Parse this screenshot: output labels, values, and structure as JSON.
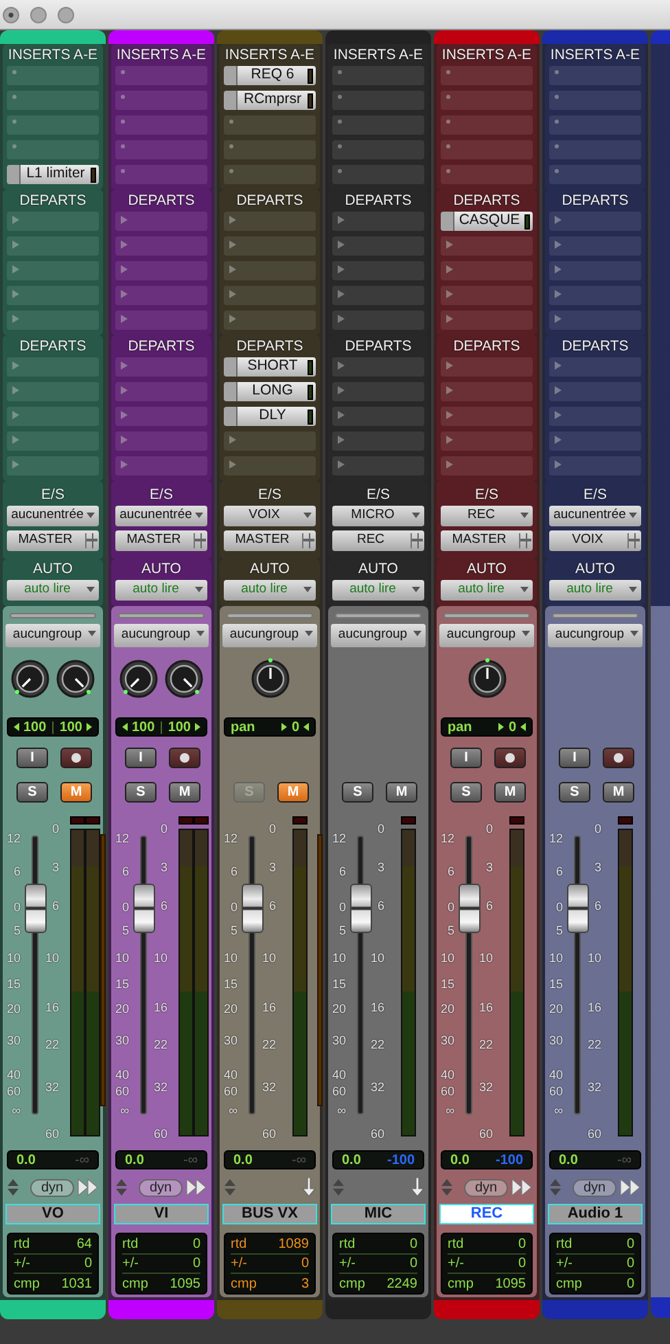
{
  "channels": [
    {
      "kind": "audio",
      "color": "#20c48a",
      "inserts": {
        "header": "INSERTS A-E",
        "slots": [
          {
            "kind": "empty"
          },
          {
            "kind": "empty"
          },
          {
            "kind": "empty"
          },
          {
            "kind": "empty"
          },
          {
            "kind": "plugin",
            "name": "L1 limiter"
          }
        ]
      },
      "sends_a": {
        "header": "DEPARTS",
        "slots": [
          {
            "kind": "empty"
          },
          {
            "kind": "empty"
          },
          {
            "kind": "empty"
          },
          {
            "kind": "empty"
          },
          {
            "kind": "empty"
          }
        ]
      },
      "sends_b": {
        "header": "DEPARTS",
        "slots": [
          {
            "kind": "empty"
          },
          {
            "kind": "empty"
          },
          {
            "kind": "empty"
          },
          {
            "kind": "empty"
          },
          {
            "kind": "empty"
          }
        ]
      },
      "io": {
        "header": "E/S",
        "input": "aucunentrée",
        "output": "MASTER"
      },
      "automation": {
        "header": "AUTO",
        "mode": "auto lire"
      },
      "group": "aucungroup",
      "pan": {
        "kind": "stereo",
        "knobs": [
          {
            "kind": "left"
          },
          {
            "kind": "right"
          }
        ],
        "values": [
          "100",
          "100"
        ]
      },
      "input_buttons": [
        {
          "kind": "input",
          "label": "I"
        },
        {
          "kind": "record",
          "armed": false
        }
      ],
      "solo": {
        "label": "S",
        "on": false,
        "disabled": false
      },
      "mute": {
        "label": "M",
        "on": true
      },
      "fader_scale": [
        "12",
        "6",
        "0",
        "5",
        "10",
        "15",
        "20",
        "30",
        "40",
        "60",
        "∞"
      ],
      "meter_scale": [
        "0",
        "3",
        "6",
        "10",
        "16",
        "22",
        "32",
        "60"
      ],
      "fader": {
        "level": 0.745
      },
      "meter": {
        "kind": "stereo"
      },
      "gain_reduction": true,
      "volume": "0.0",
      "peak": {
        "text": "-∞",
        "active": false
      },
      "dyn": "dyn",
      "name": {
        "text": "VO",
        "selected": false
      },
      "delay": {
        "warning": false,
        "rows": [
          {
            "label": "rtd",
            "value": "64"
          },
          {
            "label": "+/-",
            "value": "0"
          },
          {
            "label": "cmp",
            "value": "1031"
          }
        ]
      }
    },
    {
      "kind": "audio",
      "color": "#c000ff",
      "inserts": {
        "header": "INSERTS A-E",
        "slots": [
          {
            "kind": "empty"
          },
          {
            "kind": "empty"
          },
          {
            "kind": "empty"
          },
          {
            "kind": "empty"
          },
          {
            "kind": "empty"
          }
        ]
      },
      "sends_a": {
        "header": "DEPARTS",
        "slots": [
          {
            "kind": "empty"
          },
          {
            "kind": "empty"
          },
          {
            "kind": "empty"
          },
          {
            "kind": "empty"
          },
          {
            "kind": "empty"
          }
        ]
      },
      "sends_b": {
        "header": "DEPARTS",
        "slots": [
          {
            "kind": "empty"
          },
          {
            "kind": "empty"
          },
          {
            "kind": "empty"
          },
          {
            "kind": "empty"
          },
          {
            "kind": "empty"
          }
        ]
      },
      "io": {
        "header": "E/S",
        "input": "aucunentrée",
        "output": "MASTER"
      },
      "automation": {
        "header": "AUTO",
        "mode": "auto lire"
      },
      "group": "aucungroup",
      "pan": {
        "kind": "stereo",
        "knobs": [
          {
            "kind": "left"
          },
          {
            "kind": "right"
          }
        ],
        "values": [
          "100",
          "100"
        ]
      },
      "input_buttons": [
        {
          "kind": "input",
          "label": "I"
        },
        {
          "kind": "record",
          "armed": false
        }
      ],
      "solo": {
        "label": "S",
        "on": false,
        "disabled": false
      },
      "mute": {
        "label": "M",
        "on": false
      },
      "fader_scale": [
        "12",
        "6",
        "0",
        "5",
        "10",
        "15",
        "20",
        "30",
        "40",
        "60",
        "∞"
      ],
      "meter_scale": [
        "0",
        "3",
        "6",
        "10",
        "16",
        "22",
        "32",
        "60"
      ],
      "fader": {
        "level": 0.745
      },
      "meter": {
        "kind": "stereo"
      },
      "gain_reduction": false,
      "volume": "0.0",
      "peak": {
        "text": "-∞",
        "active": false
      },
      "dyn": "dyn",
      "name": {
        "text": "VI",
        "selected": false
      },
      "delay": {
        "warning": false,
        "rows": [
          {
            "label": "rtd",
            "value": "0"
          },
          {
            "label": "+/-",
            "value": "0"
          },
          {
            "label": "cmp",
            "value": "1095"
          }
        ]
      }
    },
    {
      "kind": "aux",
      "color": "#5a4a14",
      "inserts": {
        "header": "INSERTS A-E",
        "slots": [
          {
            "kind": "plugin",
            "name": "REQ 6"
          },
          {
            "kind": "plugin",
            "name": "RCmprsr"
          },
          {
            "kind": "empty"
          },
          {
            "kind": "empty"
          },
          {
            "kind": "empty"
          }
        ]
      },
      "sends_a": {
        "header": "DEPARTS",
        "slots": [
          {
            "kind": "empty"
          },
          {
            "kind": "empty"
          },
          {
            "kind": "empty"
          },
          {
            "kind": "empty"
          },
          {
            "kind": "empty"
          }
        ]
      },
      "sends_b": {
        "header": "DEPARTS",
        "slots": [
          {
            "kind": "plugin",
            "name": "SHORT"
          },
          {
            "kind": "plugin",
            "name": "LONG"
          },
          {
            "kind": "plugin",
            "name": "DLY"
          },
          {
            "kind": "empty"
          },
          {
            "kind": "empty"
          }
        ]
      },
      "io": {
        "header": "E/S",
        "input": "VOIX",
        "output": "MASTER"
      },
      "automation": {
        "header": "AUTO",
        "mode": "auto lire"
      },
      "group": "aucungroup",
      "pan": {
        "kind": "mono",
        "knobs": [
          {
            "kind": "center"
          }
        ],
        "label": "pan",
        "value": "0"
      },
      "solo": {
        "label": "S",
        "on": false,
        "disabled": true
      },
      "mute": {
        "label": "M",
        "on": true
      },
      "fader_scale": [
        "12",
        "6",
        "0",
        "5",
        "10",
        "15",
        "20",
        "30",
        "40",
        "60",
        "∞"
      ],
      "meter_scale": [
        "0",
        "3",
        "6",
        "10",
        "16",
        "22",
        "32",
        "60"
      ],
      "fader": {
        "level": 0.745
      },
      "meter": {
        "kind": "mono"
      },
      "gain_reduction": true,
      "volume": "0.0",
      "peak": {
        "text": "-∞",
        "active": false
      },
      "name": {
        "text": "BUS VX",
        "selected": false
      },
      "delay": {
        "warning": true,
        "rows": [
          {
            "label": "rtd",
            "value": "1089"
          },
          {
            "label": "+/-",
            "value": "0"
          },
          {
            "label": "cmp",
            "value": "3"
          }
        ]
      }
    },
    {
      "kind": "aux",
      "color": "#222222",
      "inserts": {
        "header": "INSERTS A-E",
        "slots": [
          {
            "kind": "empty"
          },
          {
            "kind": "empty"
          },
          {
            "kind": "empty"
          },
          {
            "kind": "empty"
          },
          {
            "kind": "empty"
          }
        ]
      },
      "sends_a": {
        "header": "DEPARTS",
        "slots": [
          {
            "kind": "empty"
          },
          {
            "kind": "empty"
          },
          {
            "kind": "empty"
          },
          {
            "kind": "empty"
          },
          {
            "kind": "empty"
          }
        ]
      },
      "sends_b": {
        "header": "DEPARTS",
        "slots": [
          {
            "kind": "empty"
          },
          {
            "kind": "empty"
          },
          {
            "kind": "empty"
          },
          {
            "kind": "empty"
          },
          {
            "kind": "empty"
          }
        ]
      },
      "io": {
        "header": "E/S",
        "input": "MICRO",
        "output": "REC"
      },
      "automation": {
        "header": "AUTO",
        "mode": "auto lire"
      },
      "group": "aucungroup",
      "solo": {
        "label": "S",
        "on": false,
        "disabled": false
      },
      "mute": {
        "label": "M",
        "on": false
      },
      "fader_scale": [
        "12",
        "6",
        "0",
        "5",
        "10",
        "15",
        "20",
        "30",
        "40",
        "60",
        "∞"
      ],
      "meter_scale": [
        "0",
        "3",
        "6",
        "10",
        "16",
        "22",
        "32",
        "60"
      ],
      "fader": {
        "level": 0.745
      },
      "meter": {
        "kind": "mono"
      },
      "gain_reduction": false,
      "volume": "0.0",
      "peak": {
        "text": "-100",
        "active": true
      },
      "name": {
        "text": "MIC",
        "selected": false
      },
      "delay": {
        "warning": false,
        "rows": [
          {
            "label": "rtd",
            "value": "0"
          },
          {
            "label": "+/-",
            "value": "0"
          },
          {
            "label": "cmp",
            "value": "2249"
          }
        ]
      }
    },
    {
      "kind": "audio",
      "color": "#c0000f",
      "inserts": {
        "header": "INSERTS A-E",
        "slots": [
          {
            "kind": "empty"
          },
          {
            "kind": "empty"
          },
          {
            "kind": "empty"
          },
          {
            "kind": "empty"
          },
          {
            "kind": "empty"
          }
        ]
      },
      "sends_a": {
        "header": "DEPARTS",
        "slots": [
          {
            "kind": "plugin",
            "name": "CASQUE"
          },
          {
            "kind": "empty"
          },
          {
            "kind": "empty"
          },
          {
            "kind": "empty"
          },
          {
            "kind": "empty"
          }
        ]
      },
      "sends_b": {
        "header": "DEPARTS",
        "slots": [
          {
            "kind": "empty"
          },
          {
            "kind": "empty"
          },
          {
            "kind": "empty"
          },
          {
            "kind": "empty"
          },
          {
            "kind": "empty"
          }
        ]
      },
      "io": {
        "header": "E/S",
        "input": "REC",
        "output": "MASTER"
      },
      "automation": {
        "header": "AUTO",
        "mode": "auto lire"
      },
      "group": "aucungroup",
      "pan": {
        "kind": "mono",
        "knobs": [
          {
            "kind": "center"
          }
        ],
        "label": "pan",
        "value": "0"
      },
      "input_buttons": [
        {
          "kind": "input",
          "label": "I"
        },
        {
          "kind": "record",
          "armed": false
        }
      ],
      "solo": {
        "label": "S",
        "on": false,
        "disabled": false
      },
      "mute": {
        "label": "M",
        "on": false
      },
      "fader_scale": [
        "12",
        "6",
        "0",
        "5",
        "10",
        "15",
        "20",
        "30",
        "40",
        "60",
        "∞"
      ],
      "meter_scale": [
        "0",
        "3",
        "6",
        "10",
        "16",
        "22",
        "32",
        "60"
      ],
      "fader": {
        "level": 0.745
      },
      "meter": {
        "kind": "mono"
      },
      "gain_reduction": false,
      "volume": "0.0",
      "peak": {
        "text": "-100",
        "active": true
      },
      "dyn": "dyn",
      "name": {
        "text": "REC",
        "selected": true
      },
      "delay": {
        "warning": false,
        "rows": [
          {
            "label": "rtd",
            "value": "0"
          },
          {
            "label": "+/-",
            "value": "0"
          },
          {
            "label": "cmp",
            "value": "1095"
          }
        ]
      }
    },
    {
      "kind": "audio",
      "color": "#1a2aa8",
      "inserts": {
        "header": "INSERTS A-E",
        "slots": [
          {
            "kind": "empty"
          },
          {
            "kind": "empty"
          },
          {
            "kind": "empty"
          },
          {
            "kind": "empty"
          },
          {
            "kind": "empty"
          }
        ]
      },
      "sends_a": {
        "header": "DEPARTS",
        "slots": [
          {
            "kind": "empty"
          },
          {
            "kind": "empty"
          },
          {
            "kind": "empty"
          },
          {
            "kind": "empty"
          },
          {
            "kind": "empty"
          }
        ]
      },
      "sends_b": {
        "header": "DEPARTS",
        "slots": [
          {
            "kind": "empty"
          },
          {
            "kind": "empty"
          },
          {
            "kind": "empty"
          },
          {
            "kind": "empty"
          },
          {
            "kind": "empty"
          }
        ]
      },
      "io": {
        "header": "E/S",
        "input": "aucunentrée",
        "output": "VOIX"
      },
      "automation": {
        "header": "AUTO",
        "mode": "auto lire"
      },
      "group": "aucungroup",
      "input_buttons": [
        {
          "kind": "input",
          "label": "I"
        },
        {
          "kind": "record",
          "armed": false
        }
      ],
      "solo": {
        "label": "S",
        "on": false,
        "disabled": false
      },
      "mute": {
        "label": "M",
        "on": false
      },
      "fader_scale": [
        "12",
        "6",
        "0",
        "5",
        "10",
        "15",
        "20",
        "30",
        "40",
        "60",
        "∞"
      ],
      "meter_scale": [
        "0",
        "3",
        "6",
        "10",
        "16",
        "22",
        "32",
        "60"
      ],
      "fader": {
        "level": 0.745
      },
      "meter": {
        "kind": "mono"
      },
      "gain_reduction": false,
      "volume": "0.0",
      "peak": {
        "text": "-∞",
        "active": false
      },
      "dyn": "dyn",
      "name": {
        "text": "Audio 1",
        "selected": false
      },
      "delay": {
        "warning": false,
        "rows": [
          {
            "label": "rtd",
            "value": "0"
          },
          {
            "label": "+/-",
            "value": "0"
          },
          {
            "label": "cmp",
            "value": "0"
          }
        ]
      }
    }
  ],
  "edge_strip": {
    "color": "#1c2cb8"
  }
}
